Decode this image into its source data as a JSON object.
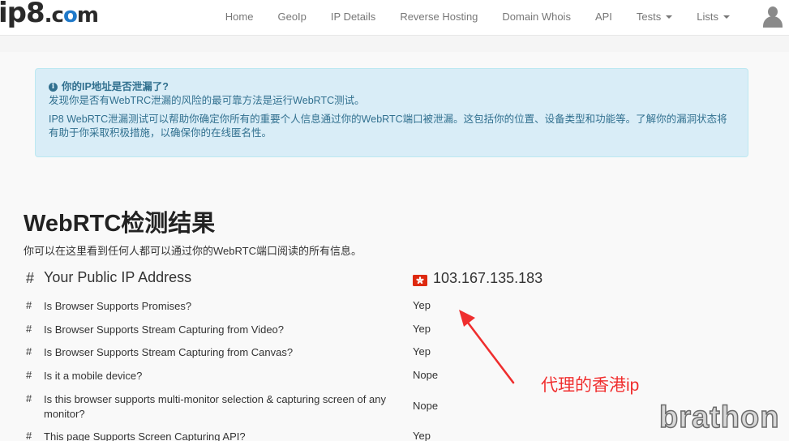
{
  "navbar": {
    "logo": {
      "ip": "ip8",
      "dot": ".c",
      "o": "o",
      "m": "m"
    },
    "links": [
      "Home",
      "GeoIp",
      "IP Details",
      "Reverse Hosting",
      "Domain Whois",
      "API",
      "Tests",
      "Lists"
    ]
  },
  "alert": {
    "title": "你的IP地址是否泄漏了?",
    "line1": "发现你是否有WebTRC泄漏的风险的最可靠方法是运行WebRTC测试。",
    "line2": "IP8 WebRTC泄漏测试可以帮助你确定你所有的重要个人信息通过你的WebRTC端口被泄漏。这包括你的位置、设备类型和功能等。了解你的漏洞状态将有助于你采取积极措施，以确保你的在线匿名性。"
  },
  "heading": "WebRTC检测结果",
  "subtitle": "你可以在这里看到任何人都可以通过你的WebRTC端口阅读的所有信息。",
  "public_ip": {
    "hash": "#",
    "label": "Your Public IP Address",
    "value": "103.167.135.183"
  },
  "results": [
    {
      "hash": "#",
      "label": "Is Browser Supports Promises?",
      "value": "Yep"
    },
    {
      "hash": "#",
      "label": "Is Browser Supports Stream Capturing from Video?",
      "value": "Yep"
    },
    {
      "hash": "#",
      "label": "Is Browser Supports Stream Capturing from Canvas?",
      "value": "Yep"
    },
    {
      "hash": "#",
      "label": "Is it a mobile device?",
      "value": "Nope"
    },
    {
      "hash": "#",
      "label": "Is this browser supports multi-monitor selection & capturing screen of any monitor?",
      "value": "Nope"
    },
    {
      "hash": "#",
      "label": "This page Supports Screen Capturing API?",
      "value": "Yep"
    }
  ],
  "annotation": "代理的香港ip",
  "watermark": "brathon",
  "colors": {
    "alert_bg": "#d9edf7",
    "alert_text": "#31708f",
    "annotation": "#ef2e2e",
    "logo_accent": "#1f79c9"
  },
  "icons": [
    "info-icon",
    "hong-kong-flag-icon",
    "user-avatar-icon",
    "caret-down-icon",
    "red-arrow"
  ]
}
